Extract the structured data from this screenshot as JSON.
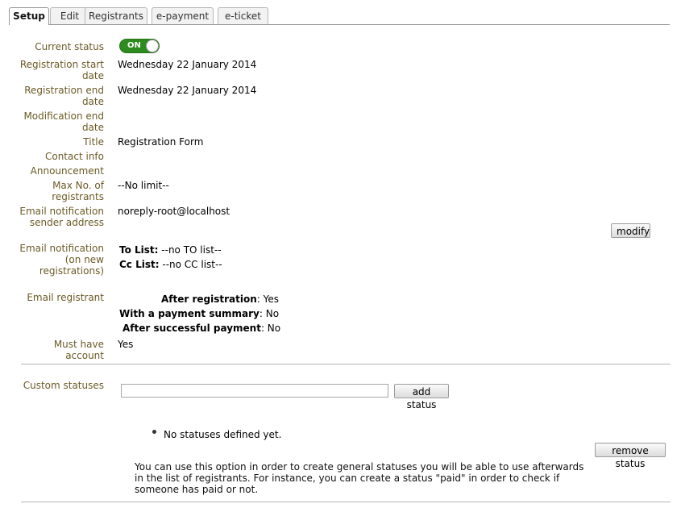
{
  "tabs": [
    {
      "label": "Setup",
      "active": true
    },
    {
      "label": "Edit",
      "active": false
    },
    {
      "label": "Registrants",
      "active": false
    },
    {
      "label": "e-payment",
      "active": false
    },
    {
      "label": "e-ticket",
      "active": false
    }
  ],
  "fields": {
    "current_status": {
      "label": "Current status",
      "toggle": "ON"
    },
    "registration_start": {
      "label": "Registration start date",
      "value": "Wednesday 22 January 2014"
    },
    "registration_end": {
      "label": "Registration end date",
      "value": "Wednesday 22 January 2014"
    },
    "modification_end": {
      "label": "Modification end date"
    },
    "title": {
      "label": "Title",
      "value": "Registration Form"
    },
    "contact_info": {
      "label": "Contact info"
    },
    "announcement": {
      "label": "Announcement"
    },
    "max_registrants": {
      "label": "Max No. of registrants",
      "value": "--No limit--"
    },
    "email_sender": {
      "label": "Email notification sender address",
      "value": "noreply-root@localhost"
    },
    "email_notification": {
      "label": "Email notification (on new registrations)",
      "to_label": "To List:",
      "to_value": "--no TO list--",
      "cc_label": "Cc List:",
      "cc_value": "--no CC list--"
    },
    "email_registrant": {
      "label": "Email registrant",
      "after_registration_label": "After registration",
      "after_registration_value": ": Yes",
      "payment_summary_label": "With a payment summary",
      "payment_summary_value": ": No",
      "after_payment_label": "After successful payment",
      "after_payment_value": ": No"
    },
    "must_have_account": {
      "label": "Must have account",
      "value": "Yes"
    }
  },
  "modify_button": "modify",
  "custom_statuses": {
    "label": "Custom statuses",
    "input_value": "",
    "add_button": "add status",
    "empty_text": "No statuses defined yet.",
    "remove_button": "remove status",
    "help_text": "You can use this option in order to create general statuses you will be able to use afterwards in the list of registrants. For instance, you can create a status \"paid\" in order to check if someone has paid or not."
  },
  "colors": {
    "label": "#6b5a25",
    "toggle_on": "#2e8b1f"
  }
}
